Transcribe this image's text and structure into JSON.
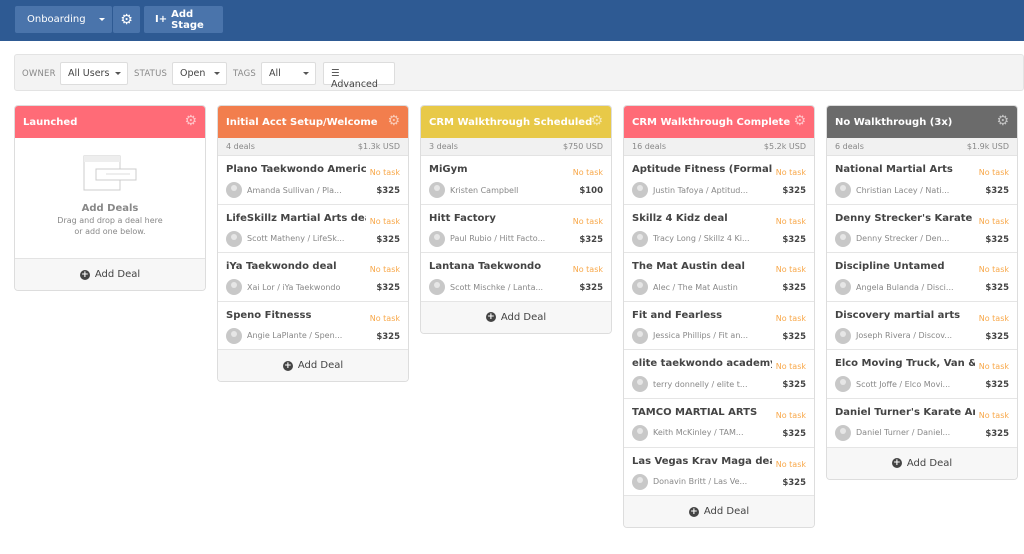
{
  "toolbar": {
    "pipeline": "Onboarding",
    "add_stage": "Add Stage"
  },
  "filters": {
    "owner_label": "OWNER",
    "owner": "All Users",
    "status_label": "STATUS",
    "status": "Open",
    "tags_label": "TAGS",
    "tags": "All",
    "advanced": "Advanced"
  },
  "colors": {
    "topbar": "#2e5a93",
    "no_task": "#f8a84a"
  },
  "add_deal": "Add Deal",
  "no_task": "No task",
  "empty": {
    "title": "Add Deals",
    "line1": "Drag and drop a deal here",
    "line2": "or add one below."
  },
  "columns": [
    {
      "title": "Launched",
      "color": "#ff6b77",
      "deals": []
    },
    {
      "title": "Initial Acct Setup/Welcome",
      "color": "#f27e4d",
      "count": "4 deals",
      "total": "$1.3k USD",
      "deals": [
        {
          "name": "Plano Taekwondo America",
          "person": "Amanda Sullivan / Pla...",
          "amount": "$325"
        },
        {
          "name": "LifeSkillz Martial Arts deal",
          "person": "Scott Matheny / LifeSk...",
          "amount": "$325"
        },
        {
          "name": "iYa Taekwondo deal",
          "person": "Xai Lor / iYa Taekwondo",
          "amount": "$325"
        },
        {
          "name": "Speno Fitnesss",
          "person": "Angie LaPlante / Spen...",
          "amount": "$325"
        }
      ]
    },
    {
      "title": "CRM Walkthrough Scheduled",
      "color": "#e8c948",
      "count": "3 deals",
      "total": "$750 USD",
      "deals": [
        {
          "name": "MiGym",
          "person": "Kristen Campbell",
          "amount": "$100"
        },
        {
          "name": "Hitt Factory",
          "person": "Paul Rubio / Hitt Facto...",
          "amount": "$325"
        },
        {
          "name": "Lantana Taekwondo",
          "person": "Scott Mischke / Lanta...",
          "amount": "$325"
        }
      ]
    },
    {
      "title": "CRM Walkthrough Complete",
      "color": "#ff6b77",
      "count": "16 deals",
      "total": "$5.2k USD",
      "deals": [
        {
          "name": "Aptitude Fitness (Formally Fit...",
          "person": "Justin Tafoya / Aptitud...",
          "amount": "$325"
        },
        {
          "name": "Skillz 4 Kidz deal",
          "person": "Tracy Long / Skillz 4 Ki...",
          "amount": "$325"
        },
        {
          "name": "The Mat Austin deal",
          "person": "Alec / The Mat Austin",
          "amount": "$325"
        },
        {
          "name": "Fit and Fearless",
          "person": "Jessica Phillips / Fit an...",
          "amount": "$325"
        },
        {
          "name": "elite taekwondo academy",
          "person": "terry donnelly / elite t...",
          "amount": "$325"
        },
        {
          "name": "TAMCO MARTIAL ARTS",
          "person": "Keith McKinley / TAM...",
          "amount": "$325"
        },
        {
          "name": "Las Vegas Krav Maga deal",
          "person": "Donavin Britt / Las Ve...",
          "amount": "$325"
        }
      ]
    },
    {
      "title": "No Walkthrough (3x)",
      "color": "#6b6b6b",
      "count": "6 deals",
      "total": "$1.9k USD",
      "deals": [
        {
          "name": "National Martial Arts",
          "person": "Christian Lacey / Nati...",
          "amount": "$325"
        },
        {
          "name": "Denny Strecker's Karate",
          "person": "Denny Strecker / Den...",
          "amount": "$325"
        },
        {
          "name": "Discipline Untamed",
          "person": "Angela Bulanda / Disci...",
          "amount": "$325"
        },
        {
          "name": "Discovery martial arts",
          "person": "Joseph Rivera / Discov...",
          "amount": "$325"
        },
        {
          "name": "Elco Moving Truck, Van & Car ...",
          "person": "Scott Joffe / Elco Movi...",
          "amount": "$325"
        },
        {
          "name": "Daniel Turner's Karate Ameri...",
          "person": "Daniel Turner / Daniel...",
          "amount": "$325"
        }
      ]
    }
  ]
}
